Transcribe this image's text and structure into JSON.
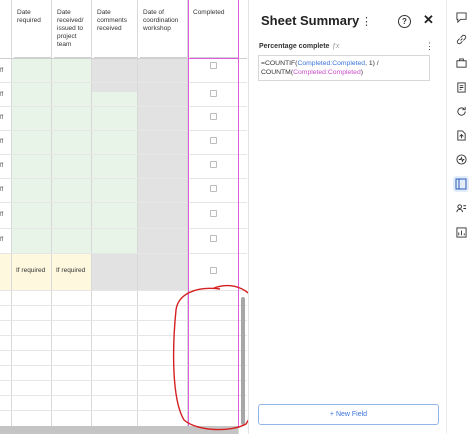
{
  "grid": {
    "columns": [
      {
        "header": "Date\nrequired"
      },
      {
        "header": "Date\nreceived/\nissued to\nproject\nteam"
      },
      {
        "header": "Date\ncomments\nreceived"
      },
      {
        "header": "Date of\ncoordination\nworkshop"
      },
      {
        "header": "Completed"
      }
    ],
    "left_marks": [
      "ff",
      "ff",
      "ff",
      "ff",
      "ff",
      "ff",
      "ff",
      "ff"
    ],
    "if_required_1": "If required",
    "if_required_2": "If required",
    "row_count_checkboxes": 9
  },
  "panel": {
    "title": "Sheet Summary",
    "field_label": "Percentage complete",
    "fx_symbol": "ƒx",
    "formula": {
      "p1": "=COUNTIF(",
      "p2": "Completed:Completed",
      "p3": ", 1) /",
      "p4": "COUNTM(",
      "p5": "Completed:Completed",
      "p6": ")"
    },
    "new_field_label": "+ New Field",
    "help_glyph": "?",
    "close_glyph": "✕",
    "kebab_glyph": "⋮"
  },
  "rail_icons": [
    "comment-icon",
    "link-icon",
    "briefcase-icon",
    "proofing-icon",
    "refresh-icon",
    "file-upload-icon",
    "activity-icon",
    "summary-icon",
    "people-icon",
    "report-icon"
  ],
  "colors": {
    "selection": "#e05ae0",
    "annotation": "#d42020",
    "green_cells": "#e8f4e8",
    "accent": "#3b73d9"
  }
}
